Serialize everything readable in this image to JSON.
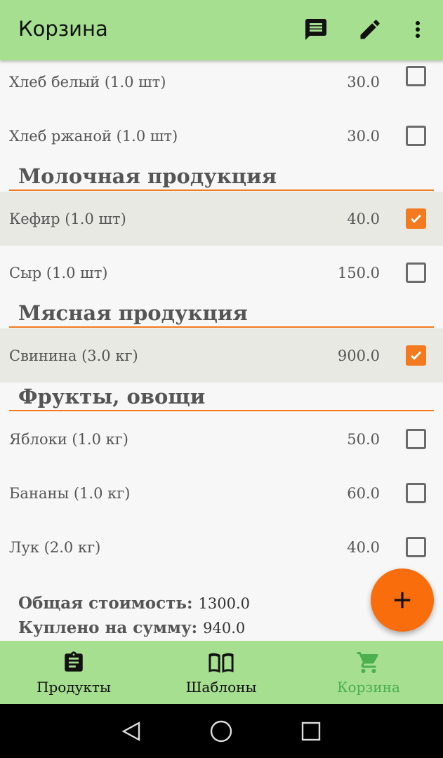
{
  "appbar": {
    "title": "Корзина",
    "actions": [
      "comment-icon",
      "edit-icon",
      "more-vert-icon"
    ]
  },
  "groups": [
    {
      "name": "",
      "items": [
        {
          "name": "Хлеб белый (1.0 шт)",
          "price": "30.0",
          "checked": false
        },
        {
          "name": "Хлеб ржаной (1.0 шт)",
          "price": "30.0",
          "checked": false
        }
      ]
    },
    {
      "name": "Молочная продукция",
      "items": [
        {
          "name": "Кефир (1.0 шт)",
          "price": "40.0",
          "checked": true
        },
        {
          "name": "Сыр (1.0 шт)",
          "price": "150.0",
          "checked": false
        }
      ]
    },
    {
      "name": "Мясная продукция",
      "items": [
        {
          "name": "Свинина (3.0 кг)",
          "price": "900.0",
          "checked": true
        }
      ]
    },
    {
      "name": "Фрукты, овощи",
      "items": [
        {
          "name": "Яблоки (1.0 кг)",
          "price": "50.0",
          "checked": false
        },
        {
          "name": "Бананы (1.0 кг)",
          "price": "60.0",
          "checked": false
        },
        {
          "name": "Лук (2.0 кг)",
          "price": "40.0",
          "checked": false
        }
      ]
    }
  ],
  "totals": {
    "total_label": "Общая стоимость:",
    "total_value": "1300.0",
    "bought_label": "Куплено на сумму:",
    "bought_value": "940.0"
  },
  "fab": {
    "icon": "plus-icon"
  },
  "bottom_nav": {
    "items": [
      {
        "label": "Продукты",
        "icon": "clipboard-icon",
        "active": false
      },
      {
        "label": "Шаблоны",
        "icon": "book-icon",
        "active": false
      },
      {
        "label": "Корзина",
        "icon": "cart-icon",
        "active": true
      }
    ]
  },
  "colors": {
    "appbar": "#a5df8f",
    "accent": "#f47a20",
    "fab": "#f96d0c",
    "active_nav": "#4caf50",
    "checked_row": "#e8e9e3"
  }
}
